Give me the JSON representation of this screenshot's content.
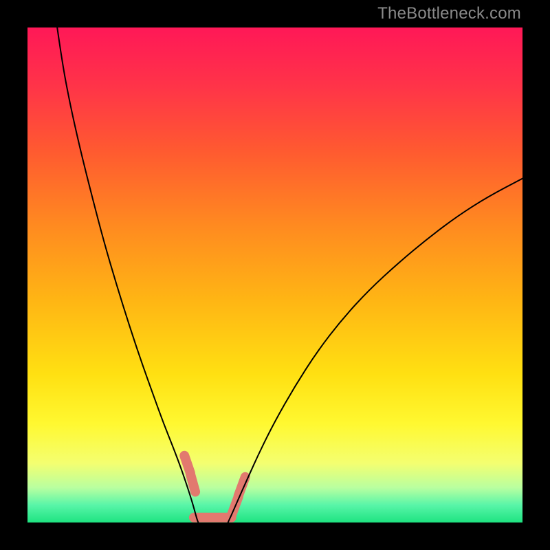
{
  "watermark": {
    "text": "TheBottleneck.com"
  },
  "chart_data": {
    "type": "line",
    "title": "",
    "xlabel": "",
    "ylabel": "",
    "xlim": [
      0,
      100
    ],
    "ylim": [
      0,
      100
    ],
    "grid": false,
    "background_gradient": {
      "stops": [
        {
          "pos": 0.0,
          "color": "#ff1857"
        },
        {
          "pos": 0.12,
          "color": "#ff3448"
        },
        {
          "pos": 0.25,
          "color": "#ff5a30"
        },
        {
          "pos": 0.4,
          "color": "#ff8a20"
        },
        {
          "pos": 0.55,
          "color": "#ffb514"
        },
        {
          "pos": 0.7,
          "color": "#ffe012"
        },
        {
          "pos": 0.8,
          "color": "#fff830"
        },
        {
          "pos": 0.88,
          "color": "#f4ff70"
        },
        {
          "pos": 0.93,
          "color": "#b8ffa0"
        },
        {
          "pos": 0.965,
          "color": "#58f5a8"
        },
        {
          "pos": 1.0,
          "color": "#1ee381"
        }
      ]
    },
    "series": [
      {
        "name": "left-curve",
        "color": "#000000",
        "width": 2,
        "points": [
          {
            "x": 6.0,
            "y": 100.0
          },
          {
            "x": 7.0,
            "y": 93.0
          },
          {
            "x": 8.5,
            "y": 85.0
          },
          {
            "x": 10.5,
            "y": 76.0
          },
          {
            "x": 13.0,
            "y": 66.0
          },
          {
            "x": 15.5,
            "y": 56.5
          },
          {
            "x": 18.0,
            "y": 48.0
          },
          {
            "x": 20.5,
            "y": 40.0
          },
          {
            "x": 23.0,
            "y": 32.5
          },
          {
            "x": 25.5,
            "y": 25.5
          },
          {
            "x": 27.5,
            "y": 20.0
          },
          {
            "x": 29.5,
            "y": 15.0
          },
          {
            "x": 31.0,
            "y": 11.0
          },
          {
            "x": 32.2,
            "y": 7.5
          },
          {
            "x": 33.0,
            "y": 5.0
          },
          {
            "x": 33.6,
            "y": 3.0
          },
          {
            "x": 34.0,
            "y": 1.5
          },
          {
            "x": 34.3,
            "y": 0.5
          },
          {
            "x": 34.5,
            "y": 0.0
          }
        ]
      },
      {
        "name": "right-curve",
        "color": "#000000",
        "width": 2,
        "points": [
          {
            "x": 40.5,
            "y": 0.0
          },
          {
            "x": 41.2,
            "y": 1.5
          },
          {
            "x": 42.5,
            "y": 4.5
          },
          {
            "x": 44.5,
            "y": 9.0
          },
          {
            "x": 47.0,
            "y": 14.5
          },
          {
            "x": 50.0,
            "y": 20.5
          },
          {
            "x": 54.0,
            "y": 27.5
          },
          {
            "x": 58.5,
            "y": 34.5
          },
          {
            "x": 63.5,
            "y": 41.0
          },
          {
            "x": 69.0,
            "y": 47.0
          },
          {
            "x": 75.0,
            "y": 52.5
          },
          {
            "x": 81.0,
            "y": 57.5
          },
          {
            "x": 87.0,
            "y": 62.0
          },
          {
            "x": 93.0,
            "y": 65.8
          },
          {
            "x": 100.0,
            "y": 69.5
          }
        ]
      }
    ],
    "peach_ticks": {
      "color": "#e2796f",
      "thickness": 14,
      "segments": [
        {
          "x1": 31.7,
          "y1": 13.5,
          "x2": 32.9,
          "y2": 10.0
        },
        {
          "x1": 32.9,
          "y1": 9.8,
          "x2": 33.9,
          "y2": 6.2
        },
        {
          "x1": 33.6,
          "y1": 1.0,
          "x2": 36.0,
          "y2": 1.0
        },
        {
          "x1": 36.2,
          "y1": 1.0,
          "x2": 38.6,
          "y2": 1.0
        },
        {
          "x1": 38.8,
          "y1": 1.0,
          "x2": 41.2,
          "y2": 1.0
        },
        {
          "x1": 41.2,
          "y1": 1.4,
          "x2": 42.6,
          "y2": 5.2
        },
        {
          "x1": 42.6,
          "y1": 5.4,
          "x2": 44.0,
          "y2": 9.2
        }
      ]
    }
  }
}
